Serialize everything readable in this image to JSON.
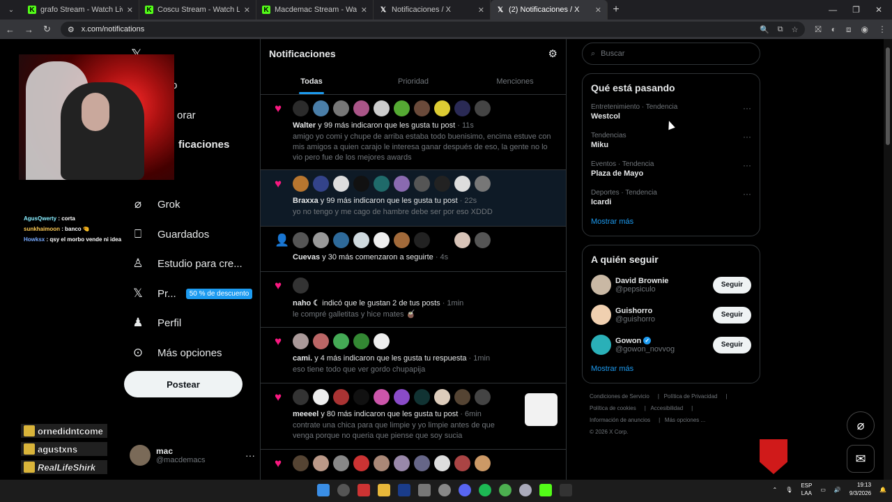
{
  "browser": {
    "tabs": [
      {
        "label": "grafo Stream - Watch Live on K",
        "favicon": "kick-icon",
        "active": false
      },
      {
        "label": "Coscu Stream - Watch Live on K",
        "favicon": "kick-icon",
        "active": false
      },
      {
        "label": "Macdemac Stream - Watch Live",
        "favicon": "kick-icon",
        "active": false
      },
      {
        "label": "Notificaciones / X",
        "favicon": "x-icon",
        "active": false
      },
      {
        "label": "(2) Notificaciones / X",
        "favicon": "x-icon",
        "active": true
      }
    ],
    "url": "x.com/notifications"
  },
  "overlay": {
    "chat": [
      {
        "user": "AgusQwerty",
        "msg": ": corta"
      },
      {
        "user": "sunkhaimoon",
        "msg": ": banco"
      },
      {
        "user": "Howksx",
        "msg": ": qsy el morbo vende ni idea"
      }
    ],
    "subs": [
      "ornedidntcome",
      "agustxns",
      "RealLifeShirk"
    ]
  },
  "nav": {
    "items": [
      {
        "label": "o",
        "icon": "home-icon"
      },
      {
        "label": "orar",
        "icon": "search-icon"
      },
      {
        "label": "ficaciones",
        "icon": "bell-icon"
      },
      {
        "label": "Grok",
        "icon": "grok-icon"
      },
      {
        "label": "Guardados",
        "icon": "bookmark-icon"
      },
      {
        "label": "Estudio para cre...",
        "icon": "studio-icon"
      },
      {
        "label": "Pr...",
        "icon": "x-premium-icon"
      },
      {
        "label": "Perfil",
        "icon": "profile-icon"
      },
      {
        "label": "Más opciones",
        "icon": "more-circle-icon"
      }
    ],
    "premium_badge": "50 % de descuento",
    "post_label": "Postear",
    "account": {
      "name": "mac",
      "handle": "@macdemacs"
    }
  },
  "main": {
    "title": "Notificaciones",
    "tabs": [
      "Todas",
      "Prioridad",
      "Menciones"
    ],
    "notifications": [
      {
        "type": "like",
        "user": "Walter",
        "rest": " y 99 más indicaron que les gusta tu post",
        "time": " · 11s",
        "quote": "amigo yo comi y chupe de arriba estaba todo buenisimo, encima estuve con mis amigos a quien carajo le interesa ganar después de eso, la gente no lo vio pero fue de los mejores awards"
      },
      {
        "type": "like",
        "user": "Braxxa",
        "rest": " y 99 más indicaron que les gusta tu post",
        "time": " · 22s",
        "quote": "yo no tengo y me cago de hambre debe ser por eso XDDD"
      },
      {
        "type": "follow",
        "user": "Cuevas",
        "rest": " y 30 más comenzaron a seguirte",
        "time": " · 4s",
        "quote": ""
      },
      {
        "type": "like",
        "user": "naho ☾",
        "rest": " indicó que le gustan 2 de tus posts",
        "time": " · 1min",
        "quote": "le compré galletitas y hice mates 🧉"
      },
      {
        "type": "like",
        "user": "cami.",
        "rest": " y 4 más indicaron que les gusta tu respuesta",
        "time": " · 1min",
        "quote": "eso tiene todo que ver gordo chupapija"
      },
      {
        "type": "like",
        "user": "meeeel",
        "rest": " y 80 más indicaron que les gusta tu post",
        "time": " · 6min",
        "quote": "contrate una chica para que limpie y yo limpie antes de que venga porque no queria que piense que soy sucia"
      },
      {
        "type": "like",
        "user": "",
        "rest": "",
        "time": "",
        "quote": ""
      }
    ]
  },
  "right": {
    "search_placeholder": "Buscar",
    "trends_title": "Qué está pasando",
    "trends": [
      {
        "cat": "Entretenimiento · Tendencia",
        "name": "Westcol"
      },
      {
        "cat": "Tendencias",
        "name": "Miku"
      },
      {
        "cat": "Eventos · Tendencia",
        "name": "Plaza de Mayo"
      },
      {
        "cat": "Deportes · Tendencia",
        "name": "Icardi"
      }
    ],
    "show_more": "Mostrar más",
    "who_title": "A quién seguir",
    "who": [
      {
        "name": "David Brownie",
        "handle": "@pepsiculo",
        "verified": false
      },
      {
        "name": "Guishorro",
        "handle": "@guishorro",
        "verified": false
      },
      {
        "name": "Gowon",
        "handle": "@gowon_novvog",
        "verified": true
      }
    ],
    "follow_label": "Seguir",
    "footer": [
      "Condiciones de Servicio",
      "Política de Privacidad",
      "Política de cookies",
      "Accesibilidad",
      "Información de anuncios",
      "Más opciones ...",
      "© 2026 X Corp."
    ]
  },
  "taskbar": {
    "lang1": "ESP",
    "lang2": "LAA",
    "time": "19:13",
    "date": "9/3/2026"
  }
}
